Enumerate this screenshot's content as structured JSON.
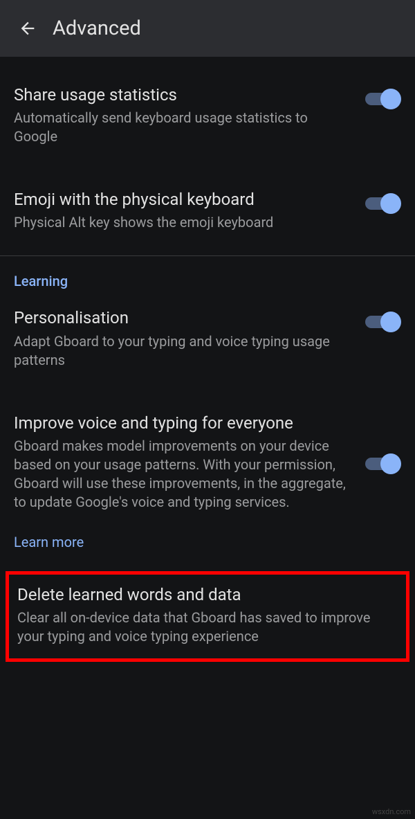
{
  "header": {
    "title": "Advanced"
  },
  "settings": {
    "share_stats": {
      "title": "Share usage statistics",
      "desc": "Automatically send keyboard usage statistics to Google",
      "enabled": true
    },
    "emoji_physical": {
      "title": "Emoji with the physical keyboard",
      "desc": "Physical Alt key shows the emoji keyboard",
      "enabled": true
    },
    "personalisation": {
      "title": "Personalisation",
      "desc": "Adapt Gboard to your typing and voice typing usage patterns",
      "enabled": true
    },
    "improve_voice": {
      "title": "Improve voice and typing for everyone",
      "desc": "Gboard makes model improvements on your device based on your usage patterns. With your permission, Gboard will use these improvements, in the aggregate, to update Google's voice and typing services.",
      "enabled": true
    },
    "delete_learned": {
      "title": "Delete learned words and data",
      "desc": "Clear all on-device data that Gboard has saved to improve your typing and voice typing experience"
    }
  },
  "section": {
    "learning": "Learning"
  },
  "links": {
    "learn_more": "Learn more"
  },
  "watermark": "wsxdn.com"
}
